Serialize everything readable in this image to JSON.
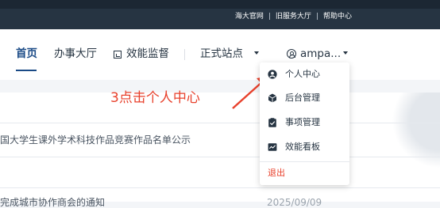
{
  "topbar": {
    "links": [
      "海大官网",
      "旧服务大厅",
      "帮助中心"
    ],
    "separator": "|"
  },
  "nav": {
    "items": [
      "首页",
      "办事大厅",
      "效能监督"
    ],
    "site_selector": "正式站点",
    "user_menu": "ampa..."
  },
  "content": {
    "rows": [
      {
        "text": "国大学生课外学术科技作品竞赛作品名单公示",
        "date": ""
      },
      {
        "text": "",
        "date": ""
      },
      {
        "text": "完成城市协作商会的通知",
        "date": "2025/09/09"
      }
    ]
  },
  "annotation": {
    "text": "3点击个人中心"
  },
  "dropdown": {
    "items": [
      {
        "label": "个人中心",
        "icon": "user-circle-icon"
      },
      {
        "label": "后台管理",
        "icon": "cube-icon"
      },
      {
        "label": "事项管理",
        "icon": "clipboard-check-icon"
      },
      {
        "label": "效能看板",
        "icon": "chart-board-icon"
      }
    ],
    "logout": "退出"
  },
  "colors": {
    "topbar": "#263442",
    "nav_active": "#1a4a86",
    "accent_red": "#e8412c"
  }
}
